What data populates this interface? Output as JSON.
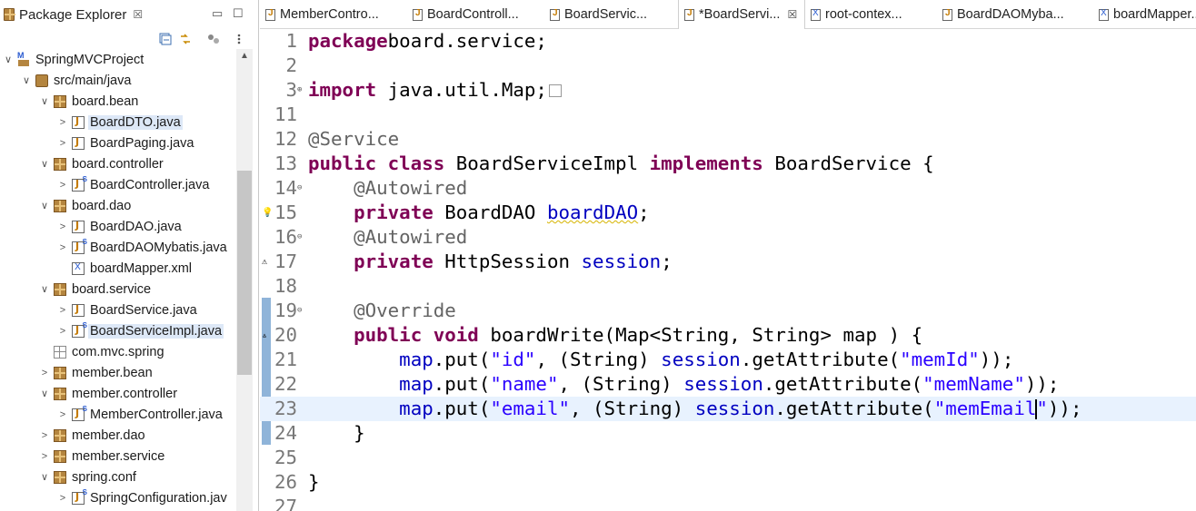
{
  "explorer": {
    "title": "Package Explorer",
    "close_glyph": "☒",
    "minimize_glyph": "▭",
    "maximize_glyph": "☐",
    "tree": [
      {
        "label": "SpringMVCProject",
        "depth": 0,
        "arrow": "∨",
        "icon": "project-icon"
      },
      {
        "label": "src/main/java",
        "depth": 1,
        "arrow": "∨",
        "icon": "source-folder-icon"
      },
      {
        "label": "board.bean",
        "depth": 2,
        "arrow": "∨",
        "icon": "package-icon"
      },
      {
        "label": "BoardDTO.java",
        "depth": 3,
        "arrow": ">",
        "icon": "java-file-icon",
        "selected": true
      },
      {
        "label": "BoardPaging.java",
        "depth": 3,
        "arrow": ">",
        "icon": "java-file-icon"
      },
      {
        "label": "board.controller",
        "depth": 2,
        "arrow": "∨",
        "icon": "package-icon"
      },
      {
        "label": "BoardController.java",
        "depth": 3,
        "arrow": ">",
        "icon": "spring-java-file-icon"
      },
      {
        "label": "board.dao",
        "depth": 2,
        "arrow": "∨",
        "icon": "package-icon"
      },
      {
        "label": "BoardDAO.java",
        "depth": 3,
        "arrow": ">",
        "icon": "java-file-icon"
      },
      {
        "label": "BoardDAOMybatis.java",
        "depth": 3,
        "arrow": ">",
        "icon": "spring-java-file-icon"
      },
      {
        "label": "boardMapper.xml",
        "depth": 3,
        "arrow": "",
        "icon": "xml-file-icon"
      },
      {
        "label": "board.service",
        "depth": 2,
        "arrow": "∨",
        "icon": "package-icon"
      },
      {
        "label": "BoardService.java",
        "depth": 3,
        "arrow": ">",
        "icon": "java-file-icon"
      },
      {
        "label": "BoardServiceImpl.java",
        "depth": 3,
        "arrow": ">",
        "icon": "spring-java-file-icon",
        "selected": true
      },
      {
        "label": "com.mvc.spring",
        "depth": 2,
        "arrow": "",
        "icon": "empty-package-icon"
      },
      {
        "label": "member.bean",
        "depth": 2,
        "arrow": ">",
        "icon": "package-icon"
      },
      {
        "label": "member.controller",
        "depth": 2,
        "arrow": "∨",
        "icon": "package-icon"
      },
      {
        "label": "MemberController.java",
        "depth": 3,
        "arrow": ">",
        "icon": "spring-java-file-icon"
      },
      {
        "label": "member.dao",
        "depth": 2,
        "arrow": ">",
        "icon": "package-icon"
      },
      {
        "label": "member.service",
        "depth": 2,
        "arrow": ">",
        "icon": "package-icon"
      },
      {
        "label": "spring.conf",
        "depth": 2,
        "arrow": "∨",
        "icon": "package-icon"
      },
      {
        "label": "SpringConfiguration.jav",
        "depth": 3,
        "arrow": ">",
        "icon": "spring-java-file-icon"
      }
    ]
  },
  "tabs": [
    {
      "label": "MemberContro...",
      "icon": "java-file-icon",
      "active": false
    },
    {
      "label": "BoardControll...",
      "icon": "java-file-icon",
      "active": false
    },
    {
      "label": "BoardServic...",
      "icon": "java-file-icon",
      "active": false
    },
    {
      "label": "*BoardServi...",
      "icon": "java-file-icon",
      "active": true,
      "close": "☒"
    },
    {
      "label": "root-contex...",
      "icon": "xml-file-icon",
      "active": false
    },
    {
      "label": "BoardDAOMyba...",
      "icon": "java-file-icon",
      "active": false
    },
    {
      "label": "boardMapper...",
      "icon": "xml-file-icon",
      "active": false
    }
  ],
  "code": [
    {
      "n": "1",
      "tokens": [
        [
          "kw",
          "package"
        ],
        [
          "",
          "board.service;"
        ]
      ]
    },
    {
      "n": "2",
      "tokens": []
    },
    {
      "n": "3",
      "mark": "⊕",
      "fold": true,
      "tokens": [
        [
          "kw",
          "import"
        ],
        [
          "",
          " java.util.Map;"
        ]
      ]
    },
    {
      "n": "11",
      "tokens": []
    },
    {
      "n": "12",
      "tokens": [
        [
          "an",
          "@Service"
        ]
      ]
    },
    {
      "n": "13",
      "tokens": [
        [
          "kw",
          "public class"
        ],
        [
          "",
          " BoardServiceImpl "
        ],
        [
          "kw",
          "implements"
        ],
        [
          "",
          " BoardService {"
        ]
      ]
    },
    {
      "n": "14",
      "mark": "⊖",
      "tokens": [
        [
          "",
          "    "
        ],
        [
          "an",
          "@Autowired"
        ]
      ]
    },
    {
      "n": "15",
      "markLeft": "💡",
      "tokens": [
        [
          "",
          "    "
        ],
        [
          "kw",
          "private"
        ],
        [
          "",
          " BoardDAO "
        ],
        [
          "fd-warn",
          "boardDAO"
        ],
        [
          "",
          ";"
        ]
      ]
    },
    {
      "n": "16",
      "mark": "⊖",
      "tokens": [
        [
          "",
          "    "
        ],
        [
          "an",
          "@Autowired"
        ]
      ]
    },
    {
      "n": "17",
      "markLeft": "⚠",
      "tokens": [
        [
          "",
          "    "
        ],
        [
          "kw",
          "private"
        ],
        [
          "",
          " HttpSession "
        ],
        [
          "fd",
          "session"
        ],
        [
          "",
          ";"
        ]
      ]
    },
    {
      "n": "18",
      "tokens": []
    },
    {
      "n": "19",
      "mark": "⊖",
      "tokens": [
        [
          "",
          "    "
        ],
        [
          "an",
          "@Override"
        ]
      ]
    },
    {
      "n": "20",
      "markLeft": "▵",
      "tokens": [
        [
          "",
          "    "
        ],
        [
          "kw",
          "public void"
        ],
        [
          "",
          " boardWrite(Map<String, String> "
        ],
        [
          "",
          "map"
        ],
        [
          "",
          " ) {"
        ]
      ]
    },
    {
      "n": "21",
      "tokens": [
        [
          "",
          "        "
        ],
        [
          "fd",
          "map"
        ],
        [
          "",
          ".put("
        ],
        [
          "st",
          "\"id\""
        ],
        [
          "",
          ", (String) "
        ],
        [
          "fd",
          "session"
        ],
        [
          "",
          ".getAttribute("
        ],
        [
          "st",
          "\"memId\""
        ],
        [
          "",
          "));"
        ]
      ]
    },
    {
      "n": "22",
      "tokens": [
        [
          "",
          "        "
        ],
        [
          "fd",
          "map"
        ],
        [
          "",
          ".put("
        ],
        [
          "st",
          "\"name\""
        ],
        [
          "",
          ", (String) "
        ],
        [
          "fd",
          "session"
        ],
        [
          "",
          ".getAttribute("
        ],
        [
          "st",
          "\"memName\""
        ],
        [
          "",
          "));"
        ]
      ]
    },
    {
      "n": "23",
      "current": true,
      "caret": true,
      "tokens": [
        [
          "",
          "        "
        ],
        [
          "fd",
          "map"
        ],
        [
          "",
          ".put("
        ],
        [
          "st",
          "\"email\""
        ],
        [
          "",
          ", (String) "
        ],
        [
          "fd",
          "session"
        ],
        [
          "",
          ".getAttribute("
        ],
        [
          "st",
          "\"memEmail"
        ],
        [
          "caret",
          ""
        ],
        [
          "st",
          "\""
        ],
        [
          "",
          "));"
        ]
      ]
    },
    {
      "n": "24",
      "tokens": [
        [
          "",
          "    }"
        ]
      ]
    },
    {
      "n": "25",
      "tokens": []
    },
    {
      "n": "26",
      "tokens": [
        [
          "",
          "}"
        ]
      ]
    },
    {
      "n": "27",
      "tokens": []
    }
  ]
}
